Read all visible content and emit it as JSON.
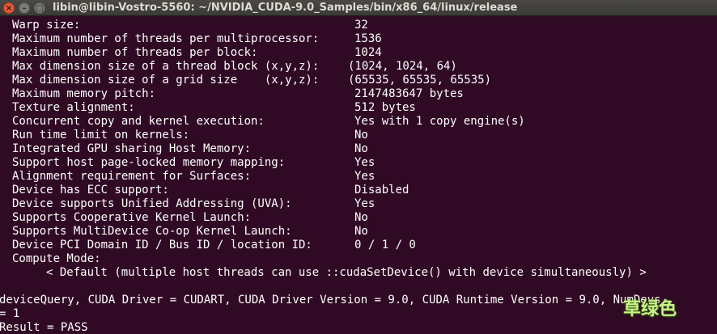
{
  "window": {
    "title": "libin@libin-Vostro-5560: ~/NVIDIA_CUDA-9.0_Samples/bin/x86_64/linux/release",
    "close_glyph": "×",
    "minimize_glyph": "–",
    "maximize_glyph": "□"
  },
  "terminal": {
    "properties": [
      {
        "label": "Warp size:",
        "value": "32"
      },
      {
        "label": "Maximum number of threads per multiprocessor:",
        "value": "1536"
      },
      {
        "label": "Maximum number of threads per block:",
        "value": "1024"
      },
      {
        "label": "Max dimension size of a thread block (x,y,z):",
        "value": "(1024, 1024, 64)"
      },
      {
        "label": "Max dimension size of a grid size    (x,y,z):",
        "value": "(65535, 65535, 65535)"
      },
      {
        "label": "Maximum memory pitch:",
        "value": "2147483647 bytes"
      },
      {
        "label": "Texture alignment:",
        "value": "512 bytes"
      },
      {
        "label": "Concurrent copy and kernel execution:",
        "value": "Yes with 1 copy engine(s)"
      },
      {
        "label": "Run time limit on kernels:",
        "value": "No"
      },
      {
        "label": "Integrated GPU sharing Host Memory:",
        "value": "No"
      },
      {
        "label": "Support host page-locked memory mapping:",
        "value": "Yes"
      },
      {
        "label": "Alignment requirement for Surfaces:",
        "value": "Yes"
      },
      {
        "label": "Device has ECC support:",
        "value": "Disabled"
      },
      {
        "label": "Device supports Unified Addressing (UVA):",
        "value": "Yes"
      },
      {
        "label": "Supports Cooperative Kernel Launch:",
        "value": "No"
      },
      {
        "label": "Supports MultiDevice Co-op Kernel Launch:",
        "value": "No"
      },
      {
        "label": "Device PCI Domain ID / Bus ID / location ID:",
        "value": "0 / 1 / 0"
      }
    ],
    "compute_mode_label": "Compute Mode:",
    "compute_mode_value": "< Default (multiple host threads can use ::cudaSetDevice() with device simultaneously) >",
    "summary_line": "deviceQuery, CUDA Driver = CUDART, CUDA Driver Version = 9.0, CUDA Runtime Version = 9.0, NumDevs",
    "summary_line_cont": "= 1",
    "result_line": "Result = PASS"
  },
  "watermark": {
    "text": "草绿色"
  }
}
